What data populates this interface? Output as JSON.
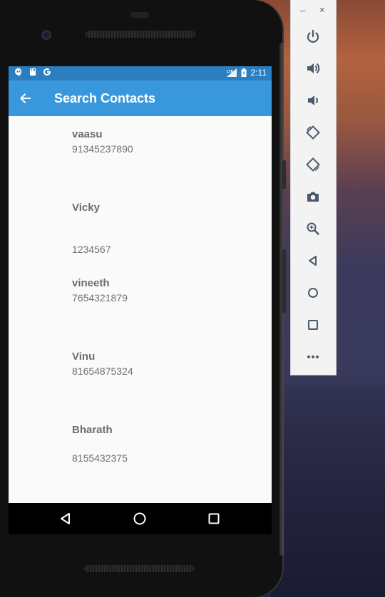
{
  "status_bar": {
    "time": "2:11",
    "network": "LTE",
    "left_icons": [
      "hangouts-icon",
      "sd-card-icon",
      "google-icon"
    ]
  },
  "app_bar": {
    "title": "Search Contacts"
  },
  "contacts": [
    {
      "name": "vaasu",
      "phone": "91345237890"
    },
    {
      "name": "Vicky",
      "phone": "1234567"
    },
    {
      "name": "vineeth",
      "phone": "7654321879"
    },
    {
      "name": "Vinu",
      "phone": "81654875324"
    },
    {
      "name": "Bharath",
      "phone": "8155432375"
    }
  ],
  "nav_bar": {
    "buttons": [
      "back-icon",
      "home-icon",
      "recents-icon"
    ]
  },
  "emulator_toolbar": {
    "minimize": "–",
    "close": "×",
    "buttons": [
      "power-icon",
      "volume-up-icon",
      "volume-down-icon",
      "rotate-left-icon",
      "rotate-right-icon",
      "camera-icon",
      "zoom-icon",
      "back-icon",
      "home-icon",
      "overview-icon",
      "more-icon"
    ]
  },
  "colors": {
    "app_bar": "#3998dc",
    "status_bar": "#2b7fc1",
    "screen_bg": "#fafafa"
  }
}
